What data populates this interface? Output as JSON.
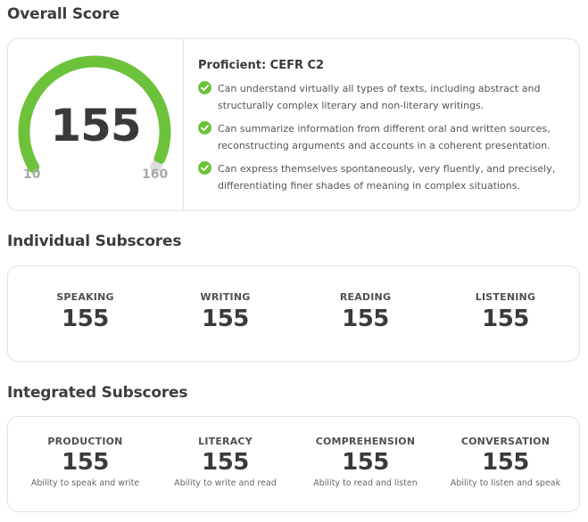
{
  "overall": {
    "title": "Overall Score",
    "score": "155",
    "min": "10",
    "max": "160",
    "score_value": 155,
    "min_value": 10,
    "max_value": 160,
    "level": "Proficient: CEFR C2",
    "bullets": [
      "Can understand virtually all types of texts, including abstract and structurally complex literary and non-literary writings.",
      "Can summarize information from different oral and written sources, reconstructing arguments and accounts in a coherent presentation.",
      "Can express themselves spontaneously, very fluently, and precisely, differentiating finer shades of meaning in complex situations."
    ]
  },
  "individual": {
    "title": "Individual Subscores",
    "items": [
      {
        "label": "SPEAKING",
        "value": "155"
      },
      {
        "label": "WRITING",
        "value": "155"
      },
      {
        "label": "READING",
        "value": "155"
      },
      {
        "label": "LISTENING",
        "value": "155"
      }
    ]
  },
  "integrated": {
    "title": "Integrated Subscores",
    "items": [
      {
        "label": "PRODUCTION",
        "value": "155",
        "desc": "Ability to speak and write"
      },
      {
        "label": "LITERACY",
        "value": "155",
        "desc": "Ability to write and read"
      },
      {
        "label": "COMPREHENSION",
        "value": "155",
        "desc": "Ability to read and listen"
      },
      {
        "label": "CONVERSATION",
        "value": "155",
        "desc": "Ability to listen and speak"
      }
    ]
  },
  "colors": {
    "accent_green": "#6cc33b",
    "track_gray": "#e6e6e6"
  },
  "icons": {
    "bullet": "check-circle-icon"
  }
}
